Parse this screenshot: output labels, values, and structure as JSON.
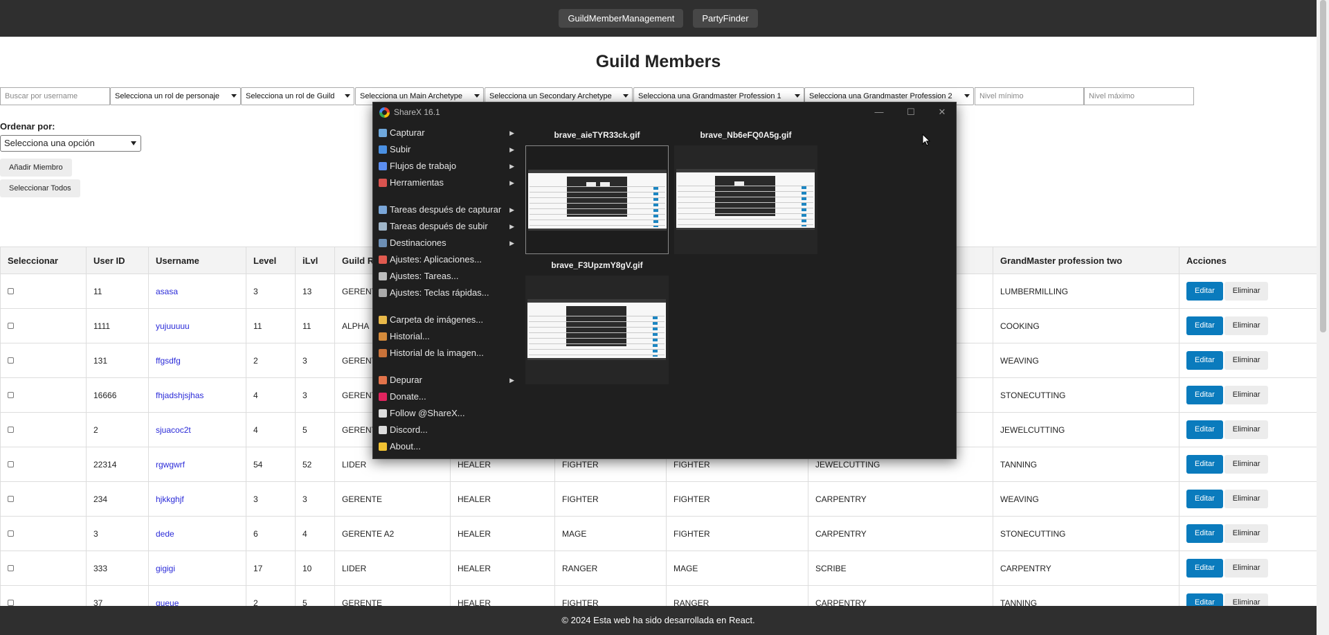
{
  "nav": {
    "items": [
      "GuildMemberManagement",
      "PartyFinder"
    ]
  },
  "page": {
    "title": "Guild Members"
  },
  "filters": {
    "search_placeholder": "Buscar por username",
    "character_role": "Selecciona un rol de personaje",
    "guild_role": "Selecciona un rol de Guild",
    "main_archetype": "Selecciona un Main Archetype",
    "secondary_archetype": "Selecciona un Secondary Archetype",
    "gm_profession_1": "Selecciona una Grandmaster Profession 1",
    "gm_profession_2": "Selecciona una Grandmaster Profession 2",
    "min_level_placeholder": "Nivel mínimo",
    "max_level_placeholder": "Nivel máximo"
  },
  "sort": {
    "label": "Ordenar por:",
    "value": "Selecciona una opción"
  },
  "buttons": {
    "add_member": "Añadir Miembro",
    "select_all": "Seleccionar Todos"
  },
  "table": {
    "headers": [
      "Seleccionar",
      "User ID",
      "Username",
      "Level",
      "iLvl",
      "Guild R",
      "",
      "",
      "",
      "",
      "GrandMaster profession two",
      "Acciones"
    ],
    "rows": [
      {
        "id": "11",
        "username": "asasa",
        "level": "3",
        "ilvl": "13",
        "guild_role": "GERENT",
        "c6": "",
        "c7": "",
        "c8": "",
        "c9": "",
        "gm2": "LUMBERMILLING"
      },
      {
        "id": "1111",
        "username": "yujuuuuu",
        "level": "11",
        "ilvl": "11",
        "guild_role": "ALPHA",
        "c6": "",
        "c7": "",
        "c8": "",
        "c9": "",
        "gm2": "COOKING"
      },
      {
        "id": "131",
        "username": "ffgsdfg",
        "level": "2",
        "ilvl": "3",
        "guild_role": "GERENT",
        "c6": "",
        "c7": "",
        "c8": "",
        "c9": "",
        "gm2": "WEAVING"
      },
      {
        "id": "16666",
        "username": "fhjadshjsjhas",
        "level": "4",
        "ilvl": "3",
        "guild_role": "GERENT",
        "c6": "",
        "c7": "",
        "c8": "",
        "c9": "",
        "gm2": "STONECUTTING"
      },
      {
        "id": "2",
        "username": "sjuacoc2t",
        "level": "4",
        "ilvl": "5",
        "guild_role": "GERENT",
        "c6": "",
        "c7": "",
        "c8": "",
        "c9": "",
        "gm2": "JEWELCUTTING"
      },
      {
        "id": "22314",
        "username": "rgwgwrf",
        "level": "54",
        "ilvl": "52",
        "guild_role": "LIDER",
        "c6": "HEALER",
        "c7": "FIGHTER",
        "c8": "FIGHTER",
        "c9": "JEWELCUTTING",
        "gm2": "TANNING"
      },
      {
        "id": "234",
        "username": "hjkkghjf",
        "level": "3",
        "ilvl": "3",
        "guild_role": "GERENTE",
        "c6": "HEALER",
        "c7": "FIGHTER",
        "c8": "FIGHTER",
        "c9": "CARPENTRY",
        "gm2": "WEAVING"
      },
      {
        "id": "3",
        "username": "dede",
        "level": "6",
        "ilvl": "4",
        "guild_role": "GERENTE A2",
        "c6": "HEALER",
        "c7": "MAGE",
        "c8": "FIGHTER",
        "c9": "CARPENTRY",
        "gm2": "STONECUTTING"
      },
      {
        "id": "333",
        "username": "gigigi",
        "level": "17",
        "ilvl": "10",
        "guild_role": "LIDER",
        "c6": "HEALER",
        "c7": "RANGER",
        "c8": "MAGE",
        "c9": "SCRIBE",
        "gm2": "CARPENTRY"
      },
      {
        "id": "37",
        "username": "queue",
        "level": "2",
        "ilvl": "5",
        "guild_role": "GERENTE",
        "c6": "HEALER",
        "c7": "FIGHTER",
        "c8": "RANGER",
        "c9": "CARPENTRY",
        "gm2": "TANNING"
      }
    ],
    "edit_label": "Editar",
    "delete_label": "Eliminar"
  },
  "footer": {
    "text": "© 2024 Esta web ha sido desarrollada en React."
  },
  "sharex": {
    "title": "ShareX 16.1",
    "menu": [
      {
        "label": "Capturar",
        "icon": "capture-icon",
        "color": "#6fa8dc",
        "sub": true
      },
      {
        "label": "Subir",
        "icon": "upload-arrow-icon",
        "color": "#4a90e2",
        "sub": true
      },
      {
        "label": "Flujos de trabajo",
        "icon": "workflow-grid-icon",
        "color": "#5b8def",
        "sub": true
      },
      {
        "label": "Herramientas",
        "icon": "toolbox-icon",
        "color": "#d9534f",
        "sub": true
      },
      {
        "gap": true
      },
      {
        "label": "Tareas después de capturar",
        "icon": "after-capture-icon",
        "color": "#7aa6d8",
        "sub": true
      },
      {
        "label": "Tareas después de subir",
        "icon": "cloud-upload-icon",
        "color": "#9fb5c8",
        "sub": true
      },
      {
        "label": "Destinaciones",
        "icon": "destinations-icon",
        "color": "#6c8fb5",
        "sub": true
      },
      {
        "label": "Ajustes: Aplicaciones...",
        "icon": "app-settings-icon",
        "color": "#e05a4f",
        "sub": false
      },
      {
        "label": "Ajustes: Tareas...",
        "icon": "gear-icon",
        "color": "#bcbcbc",
        "sub": false
      },
      {
        "label": "Ajustes: Teclas rápidas...",
        "icon": "keyboard-icon",
        "color": "#a9a9a9",
        "sub": false
      },
      {
        "gap": true
      },
      {
        "label": "Carpeta de imágenes...",
        "icon": "folder-icon",
        "color": "#e9b949",
        "sub": false
      },
      {
        "label": "Historial...",
        "icon": "history-icon",
        "color": "#d58b3b",
        "sub": false
      },
      {
        "label": "Historial de la imagen...",
        "icon": "image-history-icon",
        "color": "#c9733a",
        "sub": false
      },
      {
        "gap": true
      },
      {
        "label": "Depurar",
        "icon": "debug-icon",
        "color": "#e2734a",
        "sub": true
      },
      {
        "label": "Donate...",
        "icon": "heart-icon",
        "color": "#e0245e",
        "sub": false
      },
      {
        "label": "Follow @ShareX...",
        "icon": "x-logo-icon",
        "color": "#dddddd",
        "sub": false
      },
      {
        "label": "Discord...",
        "icon": "discord-icon",
        "color": "#dcdcdc",
        "sub": false
      },
      {
        "label": "About...",
        "icon": "crown-icon",
        "color": "#f1c232",
        "sub": false
      }
    ],
    "thumbnails": [
      {
        "name": "brave_aieTYR33ck.gif"
      },
      {
        "name": "brave_Nb6eFQ0A5g.gif"
      },
      {
        "name": "brave_F3UpzmY8gV.gif"
      }
    ]
  }
}
